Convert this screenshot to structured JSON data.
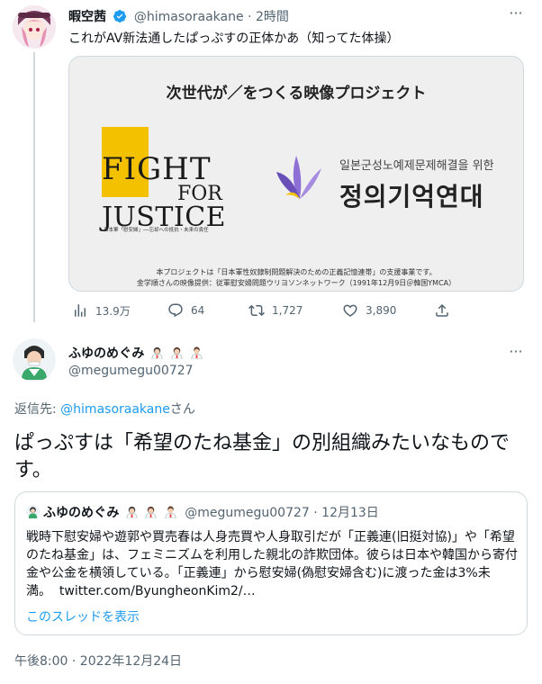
{
  "parent_tweet": {
    "display_name": "暇空茜",
    "handle": "@himasoraakane",
    "time_sep": " · ",
    "time": "2時間",
    "text": "これがAV新法通したぱっぷすの正体かあ（知ってた体操）",
    "media": {
      "heading": "次世代が／をつくる映像プロジェクト",
      "fj_line1": "FIGHT",
      "fj_line2": "FOR",
      "fj_line3": "JUSTICE",
      "fj_sub": "日本軍「慰安婦」──忘却への抵抗・未来の責任",
      "ko_small": "일본군성노예제문제해결을 위한",
      "ko_big": "정의기억연대",
      "caption1": "本プロジェクトは「日本軍性奴隷制問題解決のための正義記憶連帯」の支援事業です。",
      "caption2": "金学順さんの映像提供：従軍慰安婦問題ウリヨソンネットワーク（1991年12月9日＠韓国YMCA）"
    },
    "stats": {
      "views": "13.9万",
      "replies": "64",
      "retweets": "1,727",
      "likes": "3,890"
    }
  },
  "main_tweet": {
    "display_name": "ふゆのめぐみ",
    "handle": "@megumegu00727",
    "reply_prefix": "返信先: ",
    "reply_handle": "@himasoraakane",
    "reply_suffix": "さん",
    "text": "ぱっぷすは「希望のたね基金」の別組織みたいなものです。",
    "quote": {
      "display_name": "ふゆのめぐみ",
      "handle": "@megumegu00727",
      "time_sep": " · ",
      "date": "12月13日",
      "text": "戦時下慰安婦や遊郭や買売春は人身売買や人身取引だが「正義連(旧挺対協)」や「希望のたね基金」は、フェミニズムを利用した親北の詐欺団体。彼らは日本や韓国から寄付金や公金を横領している。「正義連」から慰安婦(偽慰安婦含む)に渡った金は3%未満。",
      "link": "twitter.com/ByungheonKim2/…",
      "thread_link": "このスレッドを表示"
    },
    "timestamp": "午後8:00 · 2022年12月24日"
  },
  "icons": [
    "verified-badge-icon",
    "more-icon",
    "views-icon",
    "reply-icon",
    "retweet-icon",
    "like-icon",
    "share-icon"
  ],
  "colors": {
    "accent": "#1d9bf0",
    "text": "#0f1419",
    "muted": "#536471",
    "border": "#cfd9de",
    "fj_yellow": "#f4c100",
    "ko_purple": "#7b5cc7"
  }
}
